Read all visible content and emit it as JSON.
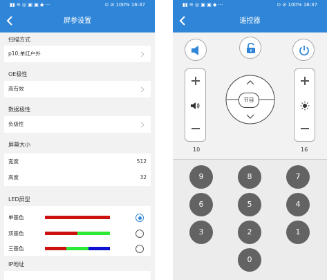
{
  "status": {
    "left_icons": "▮▮ ≋ ◎ ▣ ▣ ◆ ···",
    "right_text": "⊙ ⊘ 100%",
    "time": "16:37"
  },
  "left_screen": {
    "title": "屏参设置",
    "scan_label": "扫描方式",
    "scan_value": "p10,单红户外",
    "oe_label": "OE极性",
    "oe_value": "高有效",
    "data_label": "数据极性",
    "data_value": "负极性",
    "size_label": "屏幕大小",
    "width_label": "宽度",
    "width_value": "512",
    "height_label": "高度",
    "height_value": "32",
    "led_label": "LED屏型",
    "led_types": [
      {
        "label": "单基色",
        "selected": true,
        "colors": [
          "#cc1111"
        ]
      },
      {
        "label": "双基色",
        "selected": false,
        "colors": [
          "#cc1111",
          "#2ee836"
        ]
      },
      {
        "label": "三基色",
        "selected": false,
        "colors": [
          "#cc1111",
          "#2ee836",
          "#1010d0"
        ]
      }
    ],
    "ip_label": "IP地址"
  },
  "right_screen": {
    "title": "遥控器",
    "ok_label": "节目",
    "volume_level": "10",
    "brightness_level": "16",
    "numbers": [
      "9",
      "8",
      "7",
      "6",
      "5",
      "4",
      "3",
      "2",
      "1",
      "0"
    ]
  },
  "colors": {
    "primary": "#2f86d8",
    "number_key": "#636363",
    "background": "#f2f2f2"
  },
  "icons": [
    "back-arrow-icon",
    "chevron-right-icon",
    "speaker-icon",
    "lock-icon",
    "power-icon",
    "plus-icon",
    "minus-icon",
    "volume-icon",
    "brightness-icon",
    "arrow-up-icon",
    "arrow-down-icon"
  ]
}
